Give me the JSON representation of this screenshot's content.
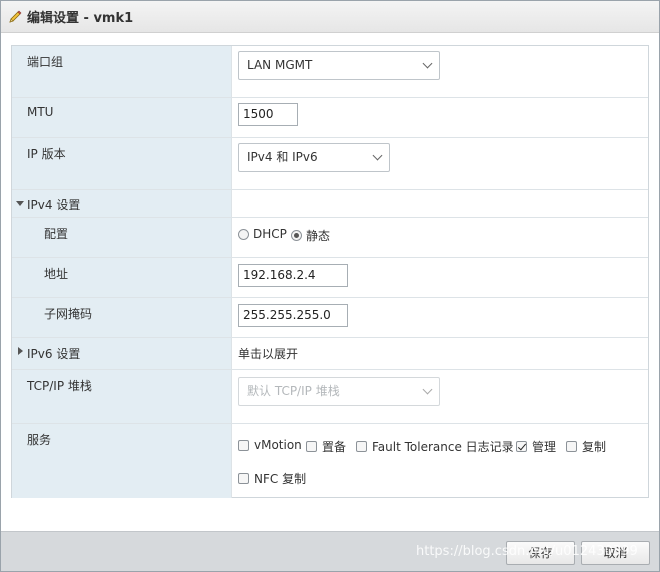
{
  "dialog": {
    "title": "编辑设置 - vmk1",
    "icon": "pencil-icon"
  },
  "form": {
    "port_group": {
      "label": "端口组",
      "value": "LAN MGMT"
    },
    "mtu": {
      "label": "MTU",
      "value": "1500"
    },
    "ip_version": {
      "label": "IP 版本",
      "value": "IPv4 和 IPv6"
    },
    "ipv4": {
      "section_label": "IPv4 设置",
      "config": {
        "label": "配置",
        "dhcp": "DHCP",
        "static": "静态",
        "selected": "static"
      },
      "address": {
        "label": "地址",
        "value": "192.168.2.4"
      },
      "subnet": {
        "label": "子网掩码",
        "value": "255.255.255.0"
      }
    },
    "ipv6": {
      "section_label": "IPv6 设置",
      "hint": "单击以展开"
    },
    "tcpip": {
      "label": "TCP/IP 堆栈",
      "value": "默认 TCP/IP 堆栈"
    },
    "services": {
      "label": "服务",
      "items": [
        {
          "label": "vMotion",
          "checked": false
        },
        {
          "label": "置备",
          "checked": false
        },
        {
          "label": "Fault Tolerance 日志记录",
          "checked": false
        },
        {
          "label": "管理",
          "checked": true
        },
        {
          "label": "复制",
          "checked": false
        },
        {
          "label": "NFC 复制",
          "checked": false
        }
      ]
    }
  },
  "footer": {
    "save": "保存",
    "cancel": "取消",
    "watermark": "https://blog.csdn.net/u012430399"
  }
}
